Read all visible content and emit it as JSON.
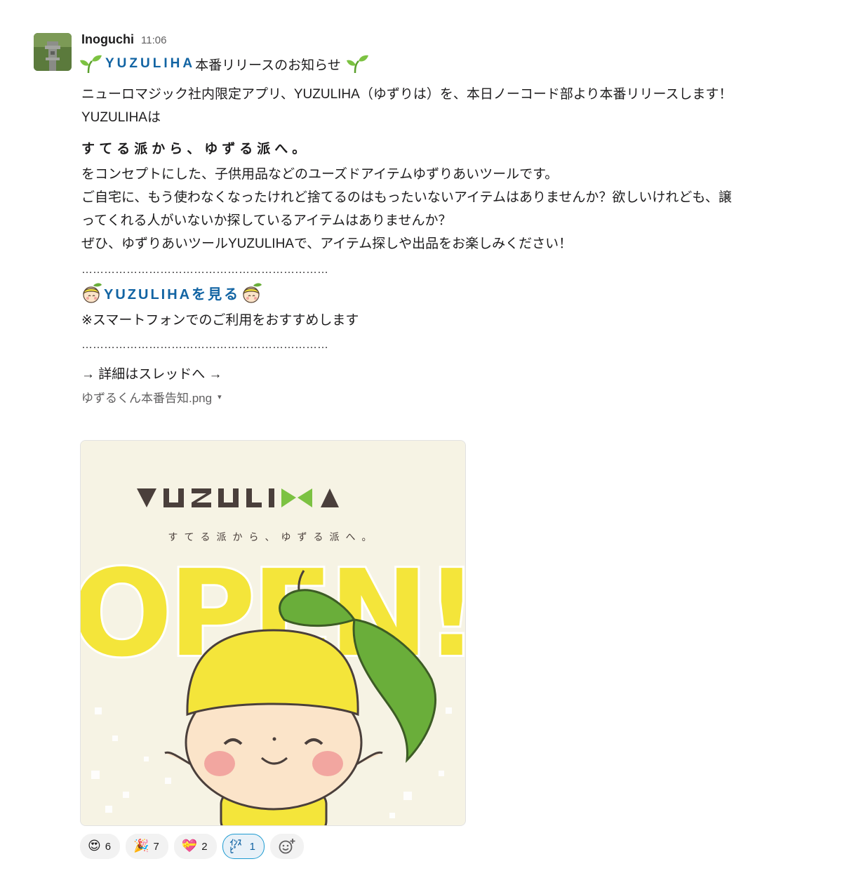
{
  "message": {
    "author": "Inoguchi",
    "time": "11:06",
    "title_brand": "YUZULIHA",
    "title_rest": "本番リリースのお知らせ",
    "body_line1": "ニューロマジック社内限定アプリ、YUZULIHA（ゆずりは）を、本日ノーコード部より本番リリースします！",
    "body_line2": "YUZULIHAは",
    "concept": "すてる派から、ゆずる派へ。",
    "paragraph": [
      "をコンセプトにした、子供用品などのユーズドアイテムゆずりあいツールです。",
      "ご自宅に、もう使わなくなったけれど捨てるのはもったいないアイテムはありませんか？欲しいけれども、譲",
      "ってくれる人がいないか探しているアイテムはありませんか？",
      "ぜひ、ゆずりあいツールYUZULIHAで、アイテム探しや出品をお楽しみください！"
    ],
    "divider": "…………………………………………………………",
    "link_text": "YUZULIHAを見る",
    "note": "※スマートフォンでのご利用をおすすめします",
    "thread_text": "→ 詳細はスレッドへ →"
  },
  "attachment": {
    "file_name": "ゆずるくん本番告知.png",
    "caret": "▾",
    "logo_text": "YUZULIHA",
    "tagline": "すてる派から、ゆずる派へ。",
    "open_text": "OPEN!"
  },
  "reactions": [
    {
      "icon": "heart-eyes-emoji",
      "emoji": "😍",
      "count": "6"
    },
    {
      "icon": "party-popper-emoji",
      "emoji": "🎉",
      "count": "7"
    },
    {
      "icon": "sparkling-heart-emoji",
      "emoji": "💝",
      "count": "2"
    },
    {
      "icon": "inspi-custom-emoji",
      "emoji": "ｲﾝｽﾋﾟ",
      "count": "1"
    }
  ],
  "colors": {
    "link": "#1264a3",
    "text": "#1d1c1d",
    "muted": "#616061",
    "yellow": "#f4e53a",
    "leaf": "#6aae3a"
  }
}
